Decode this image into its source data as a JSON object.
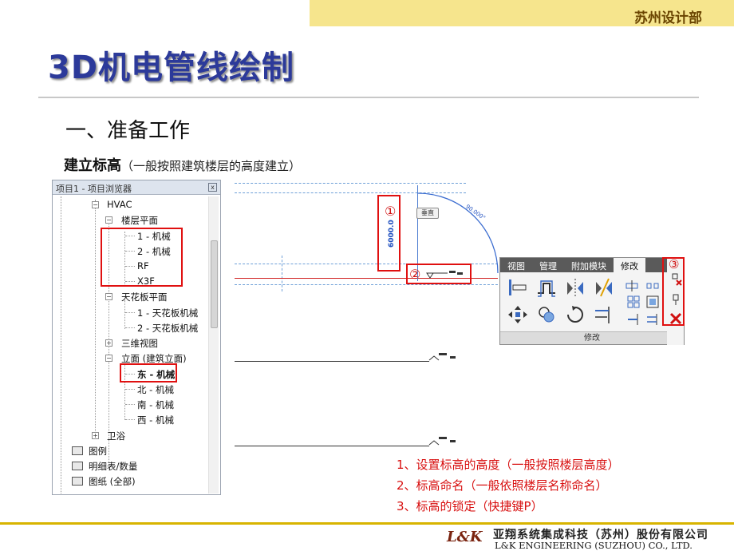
{
  "header": {
    "department": "苏州设计部"
  },
  "title": "3D机电管线绘制",
  "section": "一、准备工作",
  "subheading": {
    "bold": "建立标高",
    "note": "（一般按照建筑楼层的高度建立）"
  },
  "browser": {
    "title": "项目1 - 项目浏览器",
    "close_label": "x",
    "items": {
      "hvac": "HVAC",
      "floor_plan": "楼层平面",
      "fp_1": "1 - 机械",
      "fp_2": "2 - 机械",
      "fp_rf": "RF",
      "fp_x3f": "X3F",
      "ceiling_plan": "天花板平面",
      "cp_1": "1 - 天花板机械",
      "cp_2": "2 - 天花板机械",
      "view3d": "三维视图",
      "elevation": "立面 (建筑立面)",
      "el_east": "东 - 机械",
      "el_north": "北 - 机械",
      "el_south": "南 - 机械",
      "el_west": "西 - 机械",
      "sanitary": "卫浴",
      "legend": "图例",
      "schedules": "明细表/数量",
      "sheets": "图纸 (全部)"
    }
  },
  "drawing": {
    "marker1": "①",
    "marker2": "②",
    "marker3": "③",
    "dimension": "6000.0",
    "tooltip": "垂直",
    "arc_label": "90.000°"
  },
  "ribbon": {
    "tabs": [
      "视图",
      "管理",
      "附加模块",
      "修改"
    ],
    "active_tab": "修改",
    "panel_label": "修改"
  },
  "instructions": [
    "1、设置标高的高度（一般按照楼层高度）",
    "2、标高命名（一般依照楼层名称命名）",
    "3、标高的锁定（快捷键P）"
  ],
  "footer": {
    "logo": "L&K",
    "company_cn": "亚翔系统集成科技（苏州）股份有限公司",
    "company_en": "L&K ENGINEERING (SUZHOU) CO., LTD."
  },
  "colors": {
    "title": "#2c3a9a",
    "highlight": "#e01010",
    "band": "#f6e58d"
  }
}
